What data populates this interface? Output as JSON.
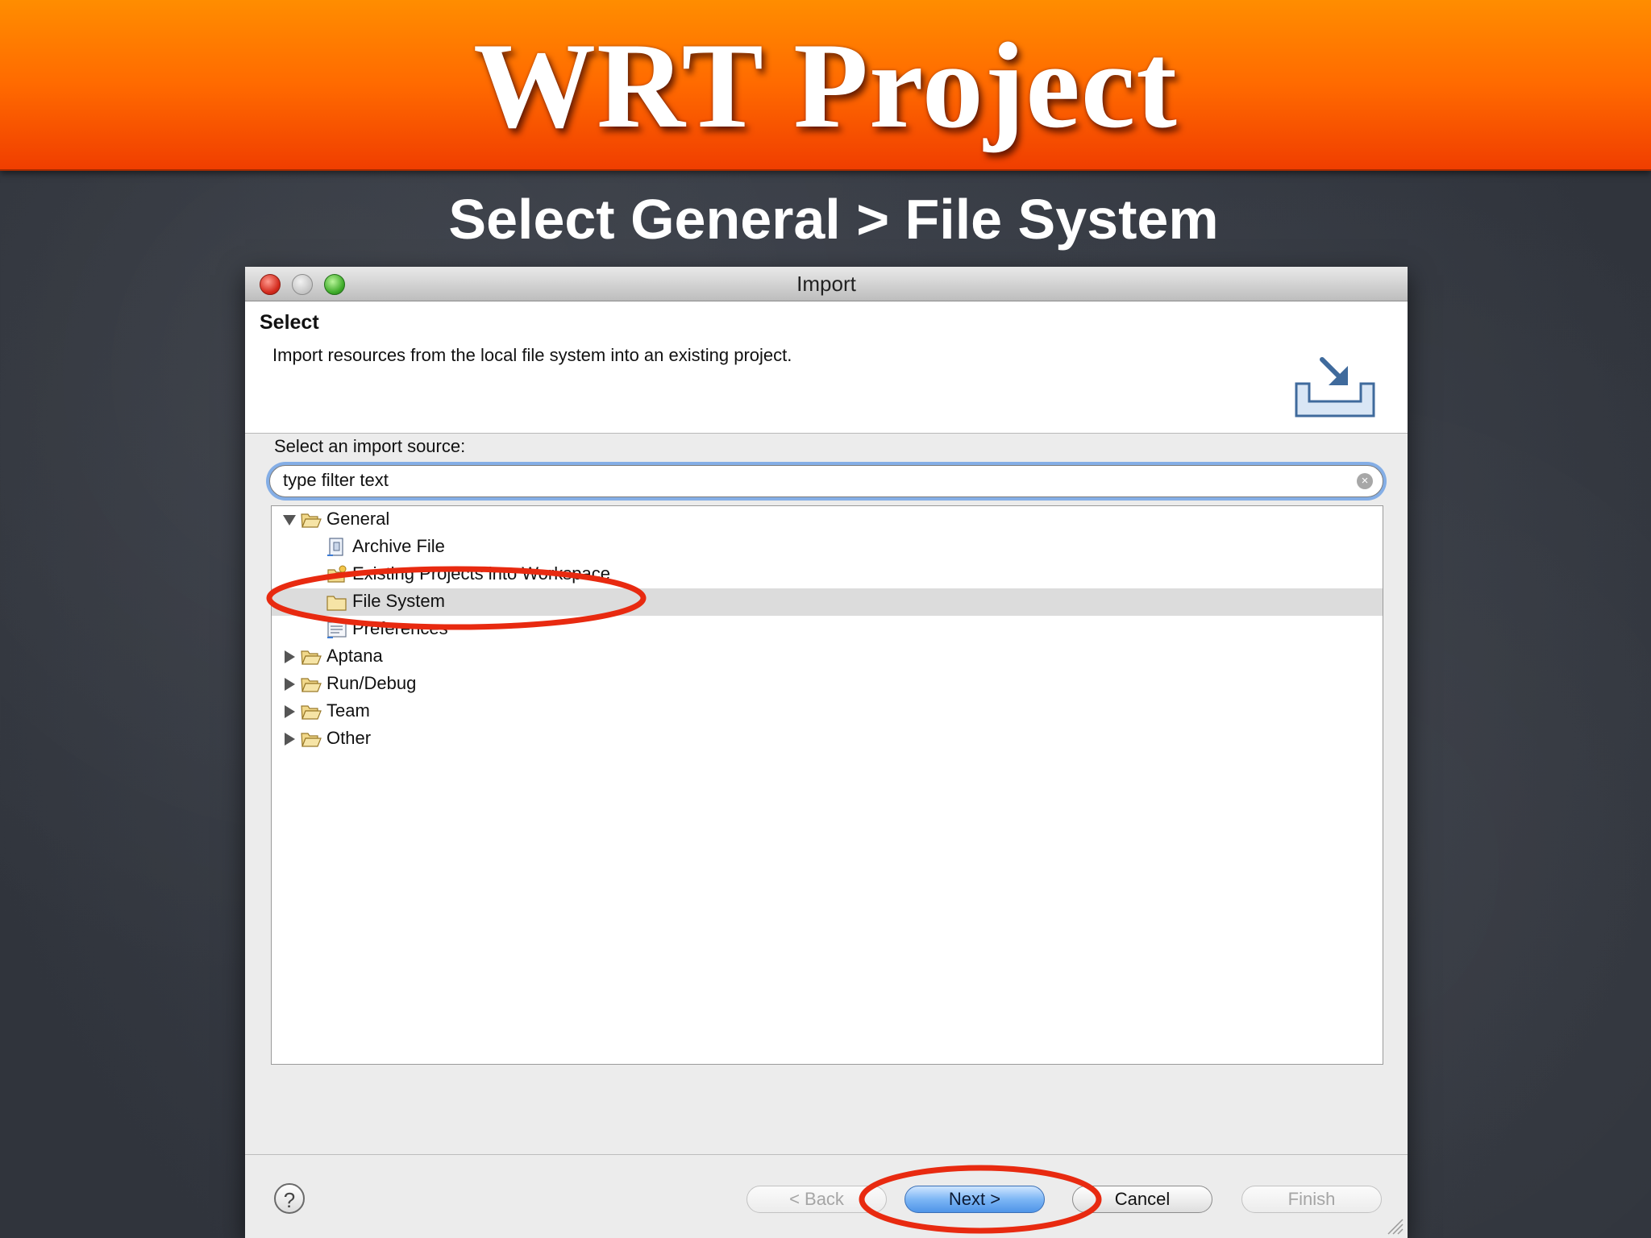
{
  "slide": {
    "title": "WRT Project",
    "subtitle": "Select General > File System"
  },
  "dialog": {
    "window_title": "Import",
    "header": {
      "heading": "Select",
      "description": "Import resources from the local file system into an existing project."
    },
    "source_label": "Select an import source:",
    "filter": {
      "value": "",
      "placeholder": "type filter text"
    },
    "tree": [
      {
        "label": "General",
        "expanded": true
      },
      {
        "label": "Archive File"
      },
      {
        "label": "Existing Projects into Workspace"
      },
      {
        "label": "File System",
        "selected": true
      },
      {
        "label": "Preferences"
      },
      {
        "label": "Aptana",
        "expanded": false
      },
      {
        "label": "Run/Debug",
        "expanded": false
      },
      {
        "label": "Team",
        "expanded": false
      },
      {
        "label": "Other",
        "expanded": false
      }
    ],
    "buttons": {
      "back": "< Back",
      "next": "Next >",
      "cancel": "Cancel",
      "finish": "Finish",
      "help": "?"
    }
  },
  "colors": {
    "banner_orange": "#ff7a00",
    "annotation_red": "#e82a10",
    "selection_gray": "#dcdcdc",
    "focus_blue": "#84aee6"
  }
}
